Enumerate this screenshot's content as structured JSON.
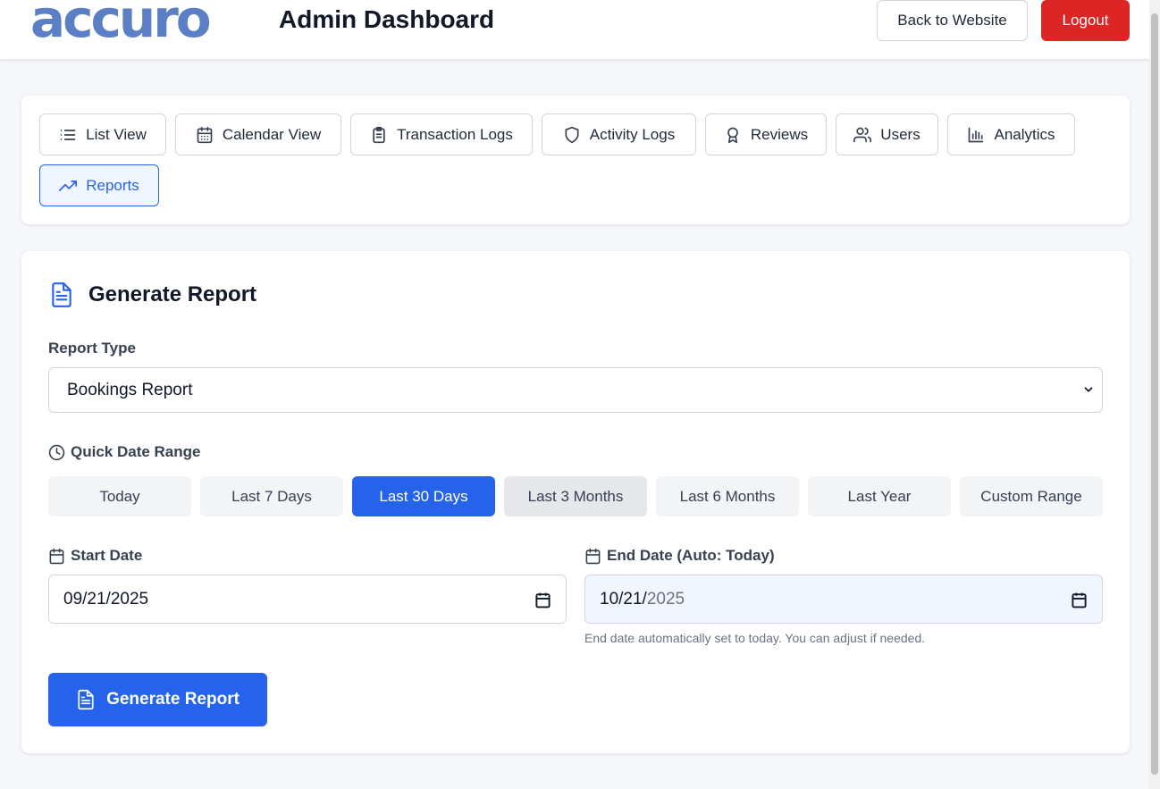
{
  "header": {
    "logo_text": "accuro",
    "title": "Admin Dashboard",
    "back_label": "Back to Website",
    "logout_label": "Logout"
  },
  "nav": {
    "tabs": [
      {
        "label": "List View",
        "icon": "list-icon"
      },
      {
        "label": "Calendar View",
        "icon": "calendar-icon"
      },
      {
        "label": "Transaction Logs",
        "icon": "clipboard-icon"
      },
      {
        "label": "Activity Logs",
        "icon": "shield-icon"
      },
      {
        "label": "Reviews",
        "icon": "award-icon"
      },
      {
        "label": "Users",
        "icon": "users-icon"
      },
      {
        "label": "Analytics",
        "icon": "bar-chart-icon"
      },
      {
        "label": "Reports",
        "icon": "trending-up-icon",
        "active": true
      }
    ]
  },
  "report": {
    "title": "Generate Report",
    "report_type_label": "Report Type",
    "report_type_value": "Bookings Report",
    "quick_range_label": "Quick Date Range",
    "ranges": [
      "Today",
      "Last 7 Days",
      "Last 30 Days",
      "Last 3 Months",
      "Last 6 Months",
      "Last Year",
      "Custom Range"
    ],
    "active_range": "Last 30 Days",
    "start_label": "Start Date",
    "start_value": "09/21/2025",
    "end_label": "End Date (Auto: Today)",
    "end_value_month_day": "10/21/",
    "end_value_year": "2025",
    "end_hint": "End date automatically set to today. You can adjust if needed.",
    "generate_label": "Generate Report"
  },
  "colors": {
    "primary": "#2563eb",
    "danger": "#dc2626",
    "logo": "#5b7fc4"
  }
}
